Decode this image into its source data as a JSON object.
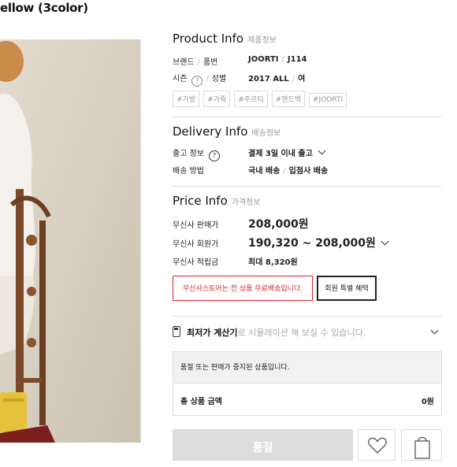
{
  "product": {
    "title": "ellow (3color)"
  },
  "product_info": {
    "heading": "Product Info",
    "sub": "제품정보",
    "brand_label": "브랜드",
    "product_no_label": "품번",
    "brand_value": "JOORTI",
    "product_no_value": "J114",
    "season_label": "시즌",
    "gender_label": "성별",
    "season_value": "2017 ALL",
    "gender_value": "여",
    "tags": [
      "#가방",
      "#가죽",
      "#주르티",
      "#핸드백",
      "#JOORTI"
    ]
  },
  "delivery_info": {
    "heading": "Delivery Info",
    "sub": "배송정보",
    "ship_label": "출고 정보",
    "ship_value": "결제 3일 이내 출고",
    "method_label": "배송 방법",
    "method_value_1": "국내 배송",
    "method_value_2": "입점사 배송"
  },
  "price_info": {
    "heading": "Price Info",
    "sub": "가격정보",
    "sale_label": "무신사 판매가",
    "sale_value": "208,000원",
    "member_label": "무신사 회원가",
    "member_value": "190,320 ~ 208,000원",
    "points_label": "무신사 적립금",
    "points_value": "최대 8,320원",
    "free_shipping_button": "무신사스토어는 전 상품 무료배송입니다.",
    "member_benefit_button": "회원 특별 혜택"
  },
  "calculator": {
    "bold_text": "최저가 계산기",
    "light_text": "로 시뮬레이션 해 보실 수 있습니다."
  },
  "order_box": {
    "notice": "품절 또는 판매가 중지된 상품입니다.",
    "total_label": "총 상품 금액",
    "total_value": "0원"
  },
  "actions": {
    "soldout_button": "품절"
  },
  "colors": {
    "accent_red": "#e2232a",
    "disabled_button": "#dcdcdc"
  },
  "icons": [
    "question-icon",
    "chevron-down-icon",
    "calculator-icon",
    "heart-icon",
    "shopping-bag-icon"
  ]
}
